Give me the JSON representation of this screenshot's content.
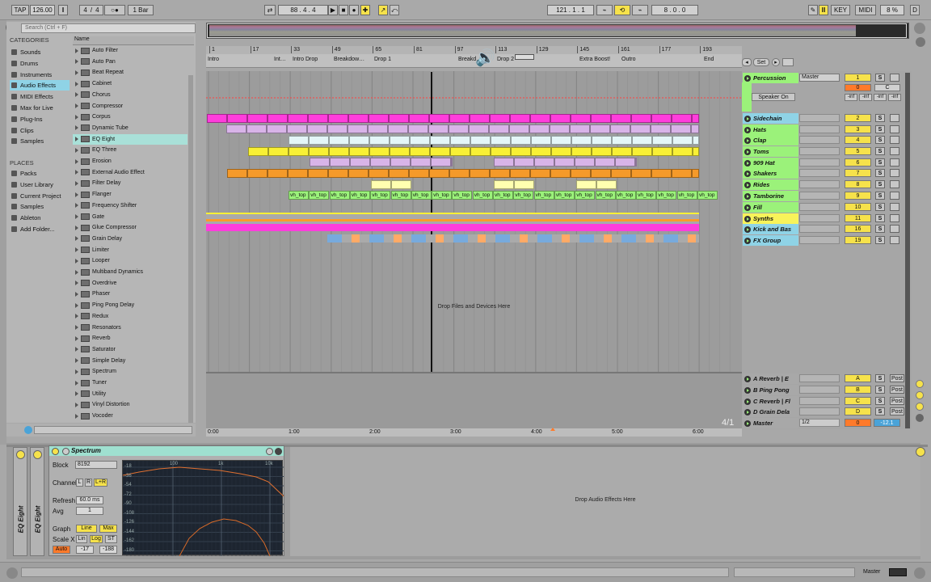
{
  "transport": {
    "tap": "TAP",
    "tempo": "126.00",
    "sig_num": "4",
    "sig_den": "4",
    "metro": "○●",
    "quant": "1 Bar",
    "position": "88 .  4 .  4",
    "loop_start": "121 .   1 .   1",
    "loop_len": "8 .   0 .   0",
    "key": "KEY",
    "midi": "MIDI",
    "cpu": "8 %",
    "d": "D"
  },
  "browser": {
    "search_placeholder": "Search (Ctrl + F)",
    "categories_title": "CATEGORIES",
    "name_header": "Name",
    "places_title": "PLACES",
    "categories": [
      "Sounds",
      "Drums",
      "Instruments",
      "Audio Effects",
      "MIDI Effects",
      "Max for Live",
      "Plug-Ins",
      "Clips",
      "Samples"
    ],
    "places": [
      "Packs",
      "User Library",
      "Current Project",
      "Samples",
      "Ableton",
      "Add Folder..."
    ],
    "items": [
      "Auto Filter",
      "Auto Pan",
      "Beat Repeat",
      "Cabinet",
      "Chorus",
      "Compressor",
      "Corpus",
      "Dynamic Tube",
      "EQ Eight",
      "EQ Three",
      "Erosion",
      "External Audio Effect",
      "Filter Delay",
      "Flanger",
      "Frequency Shifter",
      "Gate",
      "Glue Compressor",
      "Grain Delay",
      "Limiter",
      "Looper",
      "Multiband Dynamics",
      "Overdrive",
      "Phaser",
      "Ping Pong Delay",
      "Redux",
      "Resonators",
      "Reverb",
      "Saturator",
      "Simple Delay",
      "Spectrum",
      "Tuner",
      "Utility",
      "Vinyl Distortion",
      "Vocoder"
    ]
  },
  "ruler": [
    "1",
    "17",
    "33",
    "49",
    "65",
    "81",
    "97",
    "113",
    "129",
    "145",
    "161",
    "177",
    "193"
  ],
  "locators": [
    "Intro",
    "Int…",
    "Intro Drop",
    "Breakdow…",
    "Drop 1",
    "Breakd…",
    "Drop 2",
    "Extra Boost!",
    "Outro",
    "End"
  ],
  "set_label": "Set",
  "time": [
    "0:00",
    "1:00",
    "2:00",
    "3:00",
    "4:00",
    "5:00",
    "6:00"
  ],
  "drop_files": "Drop Files and Devices Here",
  "time_sig": "4/1",
  "mixer": {
    "master_out": "Master",
    "speaker": "Speaker On",
    "inf": "-inf",
    "c_label": "C",
    "zero": "0"
  },
  "tracks": [
    {
      "name": "Percussion",
      "num": "1",
      "color": "#9bf27a"
    },
    {
      "name": "Sidechain",
      "num": "2",
      "color": "#8fd3e6"
    },
    {
      "name": "Hats",
      "num": "3",
      "color": "#9bf27a"
    },
    {
      "name": "Clap",
      "num": "4",
      "color": "#9bf27a"
    },
    {
      "name": "Toms",
      "num": "5",
      "color": "#9bf27a"
    },
    {
      "name": "909 Hat",
      "num": "6",
      "color": "#9bf27a"
    },
    {
      "name": "Shakers",
      "num": "7",
      "color": "#9bf27a"
    },
    {
      "name": "Rides",
      "num": "8",
      "color": "#9bf27a"
    },
    {
      "name": "Tamborine",
      "num": "9",
      "color": "#9bf27a"
    },
    {
      "name": "Fill",
      "num": "10",
      "color": "#9bf27a"
    },
    {
      "name": "Synths",
      "num": "11",
      "color": "#f8f35a"
    },
    {
      "name": "Kick and Bas",
      "num": "16",
      "color": "#8fd3e6"
    },
    {
      "name": "FX Group",
      "num": "19",
      "color": "#8fd3e6"
    }
  ],
  "returns": [
    {
      "name": "A Reverb | E",
      "num": "A"
    },
    {
      "name": "B Ping Pong",
      "num": "B"
    },
    {
      "name": "C Reverb | Fl",
      "num": "C"
    },
    {
      "name": "D Grain Dela",
      "num": "D"
    }
  ],
  "master": {
    "name": "Master",
    "sel": "1/2",
    "vol": "0",
    "pan": "-12.1"
  },
  "s_label": "S",
  "post_label": "Post",
  "clip_label": "vh_top",
  "device": {
    "title": "Spectrum",
    "eq1": "EQ Eight",
    "eq2": "EQ Eight",
    "block_label": "Block",
    "block": "8192",
    "channel_label": "Channel",
    "ch_l": "L",
    "ch_r": "R",
    "ch_lr": "L+R",
    "refresh_label": "Refresh",
    "refresh": "60.0 ms",
    "avg_label": "Avg",
    "avg": "1",
    "graph_label": "Graph",
    "graph_line": "Line",
    "graph_max": "Max",
    "scalex_label": "Scale X",
    "lin": "Lin",
    "log": "Log",
    "st": "ST",
    "auto": "Auto",
    "range_lo": "-17",
    "range_hi": "-188",
    "freq": [
      "100",
      "1k",
      "10k"
    ],
    "db": [
      "-18",
      "-36",
      "-54",
      "-72",
      "-90",
      "-108",
      "-126",
      "-144",
      "-162",
      "-180"
    ]
  },
  "drop_audio": "Drop Audio Effects Here",
  "status_master": "Master"
}
